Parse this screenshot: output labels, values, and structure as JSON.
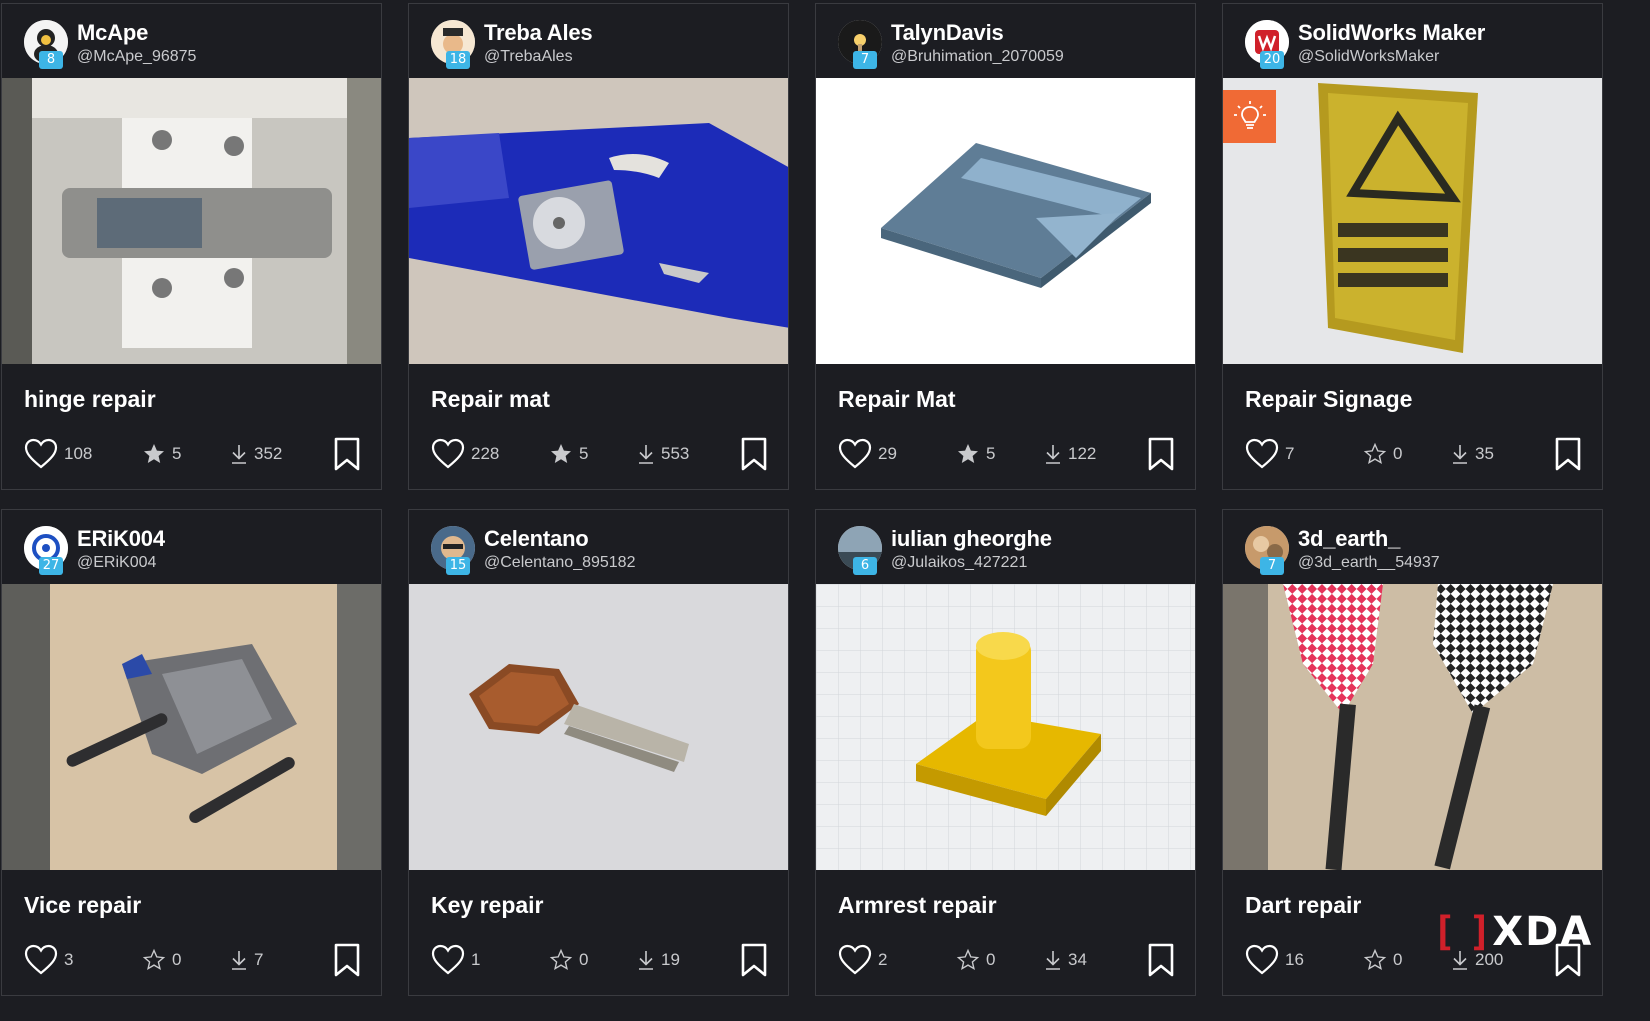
{
  "cards": [
    {
      "name": "McApe",
      "handle": "@McApe_96875",
      "level": "8",
      "title": "hinge repair",
      "likes": "108",
      "rating": "5",
      "downloads": "352",
      "rated": true,
      "badge": ""
    },
    {
      "name": "Treba Ales",
      "handle": "@TrebaAles",
      "level": "18",
      "title": "Repair mat",
      "likes": "228",
      "rating": "5",
      "downloads": "553",
      "rated": true,
      "badge": ""
    },
    {
      "name": "TalynDavis",
      "handle": "@Bruhimation_2070059",
      "level": "7",
      "title": "Repair Mat",
      "likes": "29",
      "rating": "5",
      "downloads": "122",
      "rated": true,
      "badge": ""
    },
    {
      "name": "SolidWorks Maker",
      "handle": "@SolidWorksMaker",
      "level": "20",
      "title": "Repair Signage",
      "likes": "7",
      "rating": "0",
      "downloads": "35",
      "rated": false,
      "badge": "lightbulb-icon"
    },
    {
      "name": "ERiK004",
      "handle": "@ERiK004",
      "level": "27",
      "title": "Vice repair",
      "likes": "3",
      "rating": "0",
      "downloads": "7",
      "rated": false,
      "badge": ""
    },
    {
      "name": "Celentano",
      "handle": "@Celentano_895182",
      "level": "15",
      "title": "Key repair",
      "likes": "1",
      "rating": "0",
      "downloads": "19",
      "rated": false,
      "badge": ""
    },
    {
      "name": "iulian gheorghe",
      "handle": "@Julaikos_427221",
      "level": "6",
      "title": "Armrest repair",
      "likes": "2",
      "rating": "0",
      "downloads": "34",
      "rated": false,
      "badge": ""
    },
    {
      "name": "3d_earth_",
      "handle": "@3d_earth__54937",
      "level": "7",
      "title": "Dart repair",
      "likes": "16",
      "rating": "0",
      "downloads": "200",
      "rated": false,
      "badge": ""
    }
  ],
  "watermark": {
    "text": "XDA",
    "bracket": "[ ]",
    "color": "#d0202a"
  },
  "colors": {
    "background": "#1c1d22",
    "border": "#3a3b40",
    "level_badge": "#3db5e6",
    "stat_text": "#c9cacd",
    "idea_badge": "#f06a35"
  }
}
